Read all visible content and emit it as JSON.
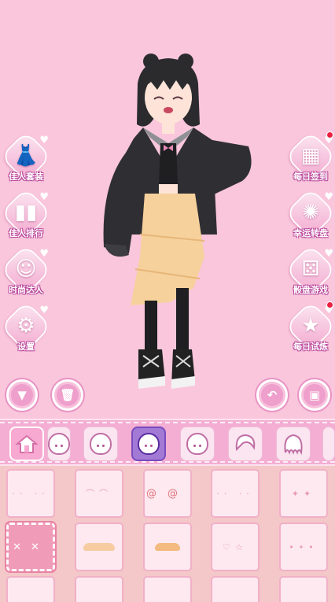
{
  "left_menu": [
    {
      "label": "佳人套装",
      "icon": "dress-icon",
      "glyph": "👗"
    },
    {
      "label": "佳人排行",
      "icon": "ranking-icon",
      "glyph": "▮▮"
    },
    {
      "label": "时尚达人",
      "icon": "silhouette-icon",
      "glyph": "☺"
    },
    {
      "label": "设置",
      "icon": "gear-icon",
      "glyph": "⚙"
    }
  ],
  "right_menu": [
    {
      "label": "每日签到",
      "icon": "calendar-icon",
      "glyph": "▦",
      "notify": true
    },
    {
      "label": "幸运转盘",
      "icon": "wheel-icon",
      "glyph": "✺",
      "notify": false
    },
    {
      "label": "骰盘游戏",
      "icon": "dice-icon",
      "glyph": "⚄",
      "notify": false
    },
    {
      "label": "每日试炼",
      "icon": "star-calendar-icon",
      "glyph": "★",
      "notify": true
    }
  ],
  "controls": {
    "collapse": "▼",
    "delete": "🗑",
    "undo": "↶",
    "save": "▣"
  },
  "categories": [
    {
      "icon": "home-icon",
      "state": "home"
    },
    {
      "icon": "face-icon",
      "state": "normal"
    },
    {
      "icon": "face-icon",
      "state": "normal"
    },
    {
      "icon": "face-icon",
      "state": "active"
    },
    {
      "icon": "face-icon",
      "state": "normal"
    },
    {
      "icon": "hair-icon",
      "state": "normal"
    },
    {
      "icon": "hair-icon",
      "state": "normal"
    },
    {
      "icon": "hair-icon",
      "state": "normal"
    }
  ],
  "items": [
    {
      "kind": "blush",
      "mark": "··  ··"
    },
    {
      "kind": "lashes",
      "mark": "⌒⌒"
    },
    {
      "kind": "swirl",
      "mark": "@@"
    },
    {
      "kind": "blush",
      "mark": "··  ··"
    },
    {
      "kind": "sparkle",
      "mark": "✦✦"
    },
    {
      "kind": "none",
      "mark": "✕✕"
    },
    {
      "kind": "brow",
      "mark": ""
    },
    {
      "kind": "brow",
      "mark": ""
    },
    {
      "kind": "heart",
      "mark": "♡☆"
    },
    {
      "kind": "dots",
      "mark": "•••"
    }
  ],
  "colors": {
    "accent": "#f4aed3",
    "active": "#a27ad6",
    "notify": "#e8213f"
  }
}
